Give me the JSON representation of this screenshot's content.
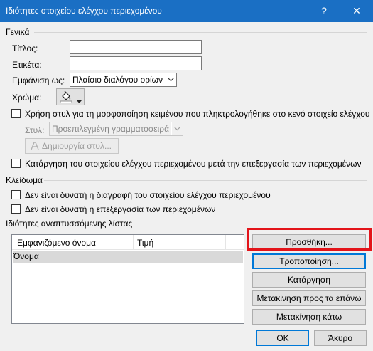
{
  "window": {
    "title": "Ιδιότητες στοιχείου ελέγχου περιεχομένου",
    "help_symbol": "?",
    "close_symbol": "✕"
  },
  "general": {
    "heading": "Γενικά",
    "title_label": "Τίτλος:",
    "title_value": "",
    "tag_label": "Ετικέτα:",
    "tag_value": "",
    "show_as_label": "Εμφάνιση ως:",
    "show_as_value": "Πλαίσιο διαλόγου ορίων",
    "color_label": "Χρώμα:",
    "color_icon": "paint-bucket-icon",
    "use_style_label": "Χρήση στυλ για τη μορφοποίηση κειμένου που πληκτρολογήθηκε στο κενό στοιχείο ελέγχου",
    "use_style_checked": false,
    "style_label": "Στυλ:",
    "style_value": "Προεπιλεγμένη γραμματοσειρά",
    "new_style_button": "Δημιουργία στυλ...",
    "remove_label": "Κατάργηση του στοιχείου ελέγχου περιεχομένου μετά την επεξεργασία των περιεχομένων",
    "remove_checked": false
  },
  "locking": {
    "heading": "Κλείδωμα",
    "no_delete_label": "Δεν είναι δυνατή η διαγραφή του στοιχείου ελέγχου περιεχομένου",
    "no_delete_checked": false,
    "no_edit_label": "Δεν είναι δυνατή η επεξεργασία των περιεχομένων",
    "no_edit_checked": false
  },
  "dropdown_props": {
    "heading": "Ιδιότητες αναπτυσσόμενης λίστας",
    "columns": [
      "Εμφανιζόμενο όνομα",
      "Τιμή"
    ],
    "rows": [
      {
        "display_name": "Όνομα",
        "value": ""
      }
    ],
    "buttons": {
      "add": "Προσθήκη...",
      "modify": "Τροποποίηση...",
      "remove": "Κατάργηση",
      "move_up": "Μετακίνηση προς τα επάνω",
      "move_down": "Μετακίνηση κάτω"
    }
  },
  "footer": {
    "ok": "OK",
    "cancel": "Άκυρο"
  },
  "colors": {
    "titlebar": "#1a6fc4",
    "highlight": "#e3141a",
    "selected_row": "#d9d9d9",
    "focus": "#0078d7"
  }
}
